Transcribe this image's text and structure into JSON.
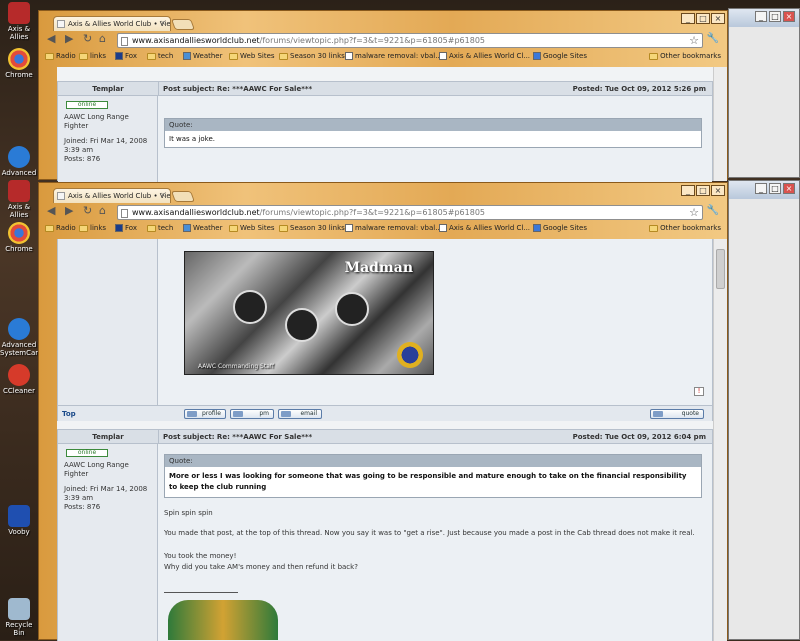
{
  "desktop": {
    "icons": [
      {
        "label": "Axis & Allies",
        "name": "axis-allies-icon"
      },
      {
        "label": "Chrome",
        "name": "chrome-icon"
      },
      {
        "label": "Advanced",
        "name": "advanced-systemcare-icon"
      },
      {
        "label": "Axis & Allies",
        "name": "axis-allies-icon-2"
      },
      {
        "label": "Chrome",
        "name": "chrome-icon-2"
      },
      {
        "label": "Advanced SystemCare",
        "name": "advanced-systemcare-icon-2"
      },
      {
        "label": "CCleaner",
        "name": "ccleaner-icon"
      },
      {
        "label": "Vooby",
        "name": "vooby-icon"
      },
      {
        "label": "Recycle Bin",
        "name": "recycle-bin-icon"
      }
    ]
  },
  "browser": {
    "tab_title": "Axis & Allies World Club • View",
    "url_host": "www.axisandalliesworldclub.net",
    "url_path": "/forums/viewtopic.php?f=3&t=9221&p=61805#p61805",
    "window_controls": [
      "_",
      "□",
      "×"
    ],
    "bookmarks": [
      {
        "label": "Radio",
        "icon": "folder"
      },
      {
        "label": "links",
        "icon": "folder"
      },
      {
        "label": "Fox",
        "icon": "fox-favicon"
      },
      {
        "label": "tech",
        "icon": "folder"
      },
      {
        "label": "Weather",
        "icon": "weather-favicon"
      },
      {
        "label": "Web Sites",
        "icon": "folder"
      },
      {
        "label": "Season 30 links",
        "icon": "folder"
      },
      {
        "label": "malware removal: vbal...",
        "icon": "page-favicon"
      },
      {
        "label": "Axis & Allies World Cl...",
        "icon": "page-favicon"
      },
      {
        "label": "Google Sites",
        "icon": "google-favicon"
      }
    ],
    "other_bookmarks": "Other bookmarks"
  },
  "top_post": {
    "col_author": "Templar",
    "subject": "Post subject: Re: ***AAWC For Sale***",
    "posted": "Posted: Tue Oct 09, 2012 5:26 pm",
    "status": "online",
    "rank": "AAWC Long Range Fighter",
    "joined": "Joined: Fri Mar 14, 2008 3:39 am",
    "posts": "Posts: 876",
    "quote_label": "Quote:",
    "quote_text": "It was a joke."
  },
  "sig": {
    "name": "Madman",
    "caption": "AAWC Commanding Staff"
  },
  "post_buttons": {
    "top": "Top",
    "profile": "profile",
    "pm": "pm",
    "email": "email",
    "quote": "quote"
  },
  "bottom_post": {
    "col_author": "Templar",
    "subject": "Post subject: Re: ***AAWC For Sale***",
    "posted": "Posted: Tue Oct 09, 2012 6:04 pm",
    "status": "online",
    "rank": "AAWC Long Range Fighter",
    "joined": "Joined: Fri Mar 14, 2008 3:39 am",
    "posts": "Posts: 876",
    "quote_label": "Quote:",
    "quote_text": "More or less I was looking for someone that was going to be responsible and mature enough to take on the financial responsibility to keep the club running",
    "lines": [
      "Spin spin spin",
      "You made that post, at the top of this thread. Now you say it was to \"get a rise\". Just because you made a post in the Cab thread does not make it real.",
      "You took the money!",
      "Why did you take AM's money and then refund it back?"
    ]
  },
  "colors": {
    "chrome_frame": "#e3a955",
    "forum_bg": "#ecf0f4",
    "header_bg": "#d9dfe6",
    "quote_header": "#a9b6c3"
  }
}
